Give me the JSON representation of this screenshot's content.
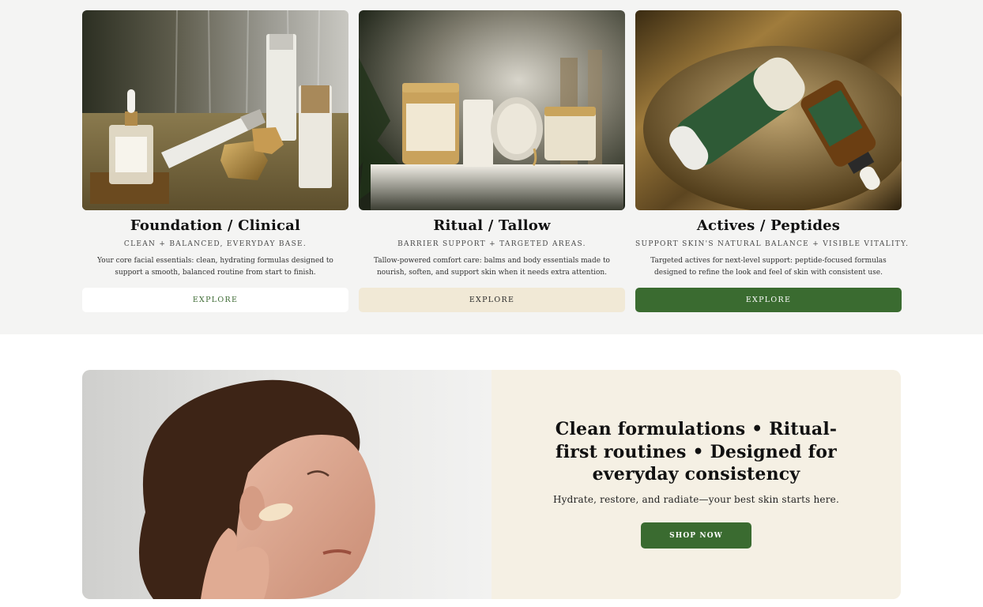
{
  "collections": [
    {
      "title": "Foundation / Clinical",
      "subtitle": "CLEAN + BALANCED, EVERYDAY BASE.",
      "description": "Your core facial essentials: clean, hydrating formulas designed to support a smooth, balanced routine from start to finish.",
      "button_label": "EXPLORE",
      "image_name": "foundation-clinical-product-photo"
    },
    {
      "title": "Ritual / Tallow",
      "subtitle": "BARRIER SUPPORT + TARGETED AREAS.",
      "description": "Tallow-powered comfort care: balms and body essentials made to nourish, soften, and support skin when it needs extra attention.",
      "button_label": "EXPLORE",
      "image_name": "ritual-tallow-product-photo"
    },
    {
      "title": "Actives / Peptides",
      "subtitle": "SUPPORT SKIN'S NATURAL BALANCE + VISIBLE VITALITY.",
      "description": "Targeted actives for next-level support: peptide-focused formulas designed to refine the look and feel of skin with consistent use.",
      "button_label": "EXPLORE",
      "image_name": "actives-peptides-product-photo"
    }
  ],
  "promo": {
    "heading": "Clean formulations • Ritual-first routines • Designed for everyday consistency",
    "subheading": "Hydrate, restore, and radiate—your best skin starts here.",
    "button_label": "SHOP NOW",
    "image_name": "woman-applying-cream-photo"
  },
  "colors": {
    "section_bg": "#f4f4f3",
    "brand_green": "#3a6b30",
    "cream": "#f1e9d6",
    "promo_bg": "#f5f0e4"
  }
}
